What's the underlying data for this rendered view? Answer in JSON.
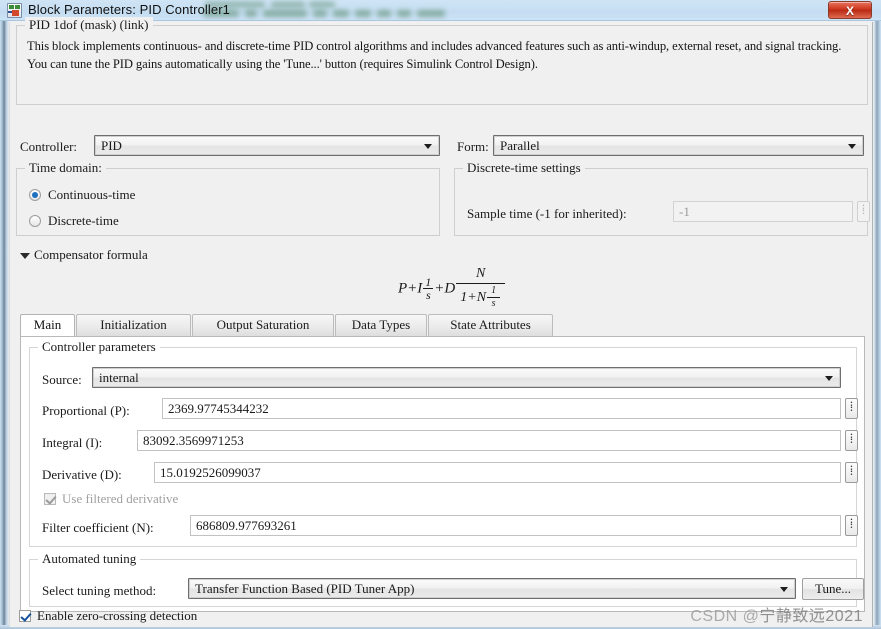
{
  "window": {
    "title": "Block Parameters: PID Controller1",
    "close_label": "X",
    "icon": "simulink-block-icon"
  },
  "description": {
    "group_title": "PID 1dof (mask) (link)",
    "text": "This block implements continuous- and discrete-time PID control algorithms and includes advanced features such as anti-windup, external reset, and signal tracking. You can tune the PID gains automatically using the 'Tune...' button (requires Simulink Control Design)."
  },
  "top": {
    "controller_label": "Controller:",
    "controller_value": "PID",
    "form_label": "Form:",
    "form_value": "Parallel"
  },
  "time_domain": {
    "group_title": "Time domain:",
    "options": [
      {
        "label": "Continuous-time",
        "selected": true
      },
      {
        "label": "Discrete-time",
        "selected": false
      }
    ]
  },
  "discrete_settings": {
    "group_title": "Discrete-time settings",
    "sample_time_label": "Sample time (-1 for inherited):",
    "sample_time_value": "-1",
    "enabled": false
  },
  "compensator": {
    "section_label": "Compensator formula",
    "expanded": true,
    "formula_parts": {
      "p": "P",
      "plus1": "+",
      "i": "I",
      "one": "1",
      "s": "s",
      "plus2": "+",
      "d": "D",
      "n_num": "N",
      "den_lead": "1+",
      "den_n": "N"
    }
  },
  "tabs": [
    {
      "label": "Main",
      "active": true
    },
    {
      "label": "Initialization",
      "active": false
    },
    {
      "label": "Output Saturation",
      "active": false
    },
    {
      "label": "Data Types",
      "active": false
    },
    {
      "label": "State Attributes",
      "active": false
    }
  ],
  "controller_parameters": {
    "group_title": "Controller parameters",
    "source_label": "Source:",
    "source_value": "internal",
    "fields": [
      {
        "label": "Proportional (P):",
        "value": "2369.97745344232"
      },
      {
        "label": "Integral (I):",
        "value": "83092.3569971253"
      },
      {
        "label": "Derivative (D):",
        "value": "15.0192526099037"
      }
    ],
    "use_filtered_derivative": {
      "label": "Use filtered derivative",
      "checked": true,
      "enabled": false
    },
    "filter_coefficient": {
      "label": "Filter coefficient (N):",
      "value": "686809.977693261"
    }
  },
  "automated_tuning": {
    "group_title": "Automated tuning",
    "method_label": "Select tuning method:",
    "method_value": "Transfer Function Based (PID Tuner App)",
    "tune_button": "Tune..."
  },
  "footer": {
    "zero_crossing": {
      "label": "Enable zero-crossing detection",
      "checked": true
    }
  },
  "watermark": {
    "prefix": "CSDN @",
    "user": "宁静致远2021"
  },
  "colors": {
    "accent": "#1d6fc0",
    "titlebar": "#cde3f6",
    "close": "#cf3a22",
    "panel": "#f0f0f0"
  }
}
